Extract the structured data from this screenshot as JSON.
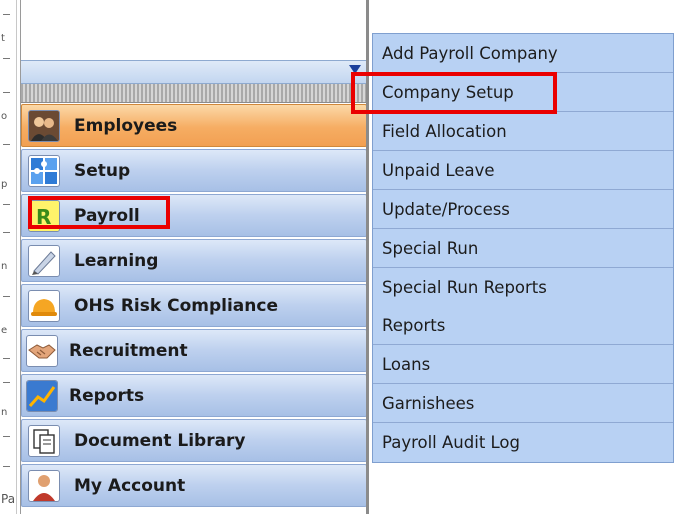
{
  "nav": {
    "items": [
      {
        "label": "Employees",
        "icon": "people-icon"
      },
      {
        "label": "Setup",
        "icon": "puzzle-icon"
      },
      {
        "label": "Payroll",
        "icon": "payroll-r-icon"
      },
      {
        "label": "Learning",
        "icon": "pencil-icon"
      },
      {
        "label": "OHS Risk Compliance",
        "icon": "hard-hat-icon"
      },
      {
        "label": "Recruitment",
        "icon": "handshake-icon"
      },
      {
        "label": "Reports",
        "icon": "chart-icon"
      },
      {
        "label": "Document Library",
        "icon": "document-icon"
      },
      {
        "label": "My Account",
        "icon": "user-icon"
      }
    ],
    "collapse_icon": "triangle-down-icon"
  },
  "submenu": {
    "items": [
      "Add Payroll Company",
      "Company Setup",
      "Field Allocation",
      "Unpaid Leave",
      "Update/Process",
      "Special Run",
      "Special Run Reports",
      "Reports",
      "Loans",
      "Garnishees",
      "Payroll Audit Log"
    ]
  },
  "ruler": {
    "marks": [
      "t",
      "o",
      "p",
      "n",
      "e",
      "n",
      "Pa"
    ]
  },
  "colors": {
    "highlight": "#ea0000",
    "active_item": "#f6ad63",
    "menu_bg": "#b8d1f3"
  }
}
